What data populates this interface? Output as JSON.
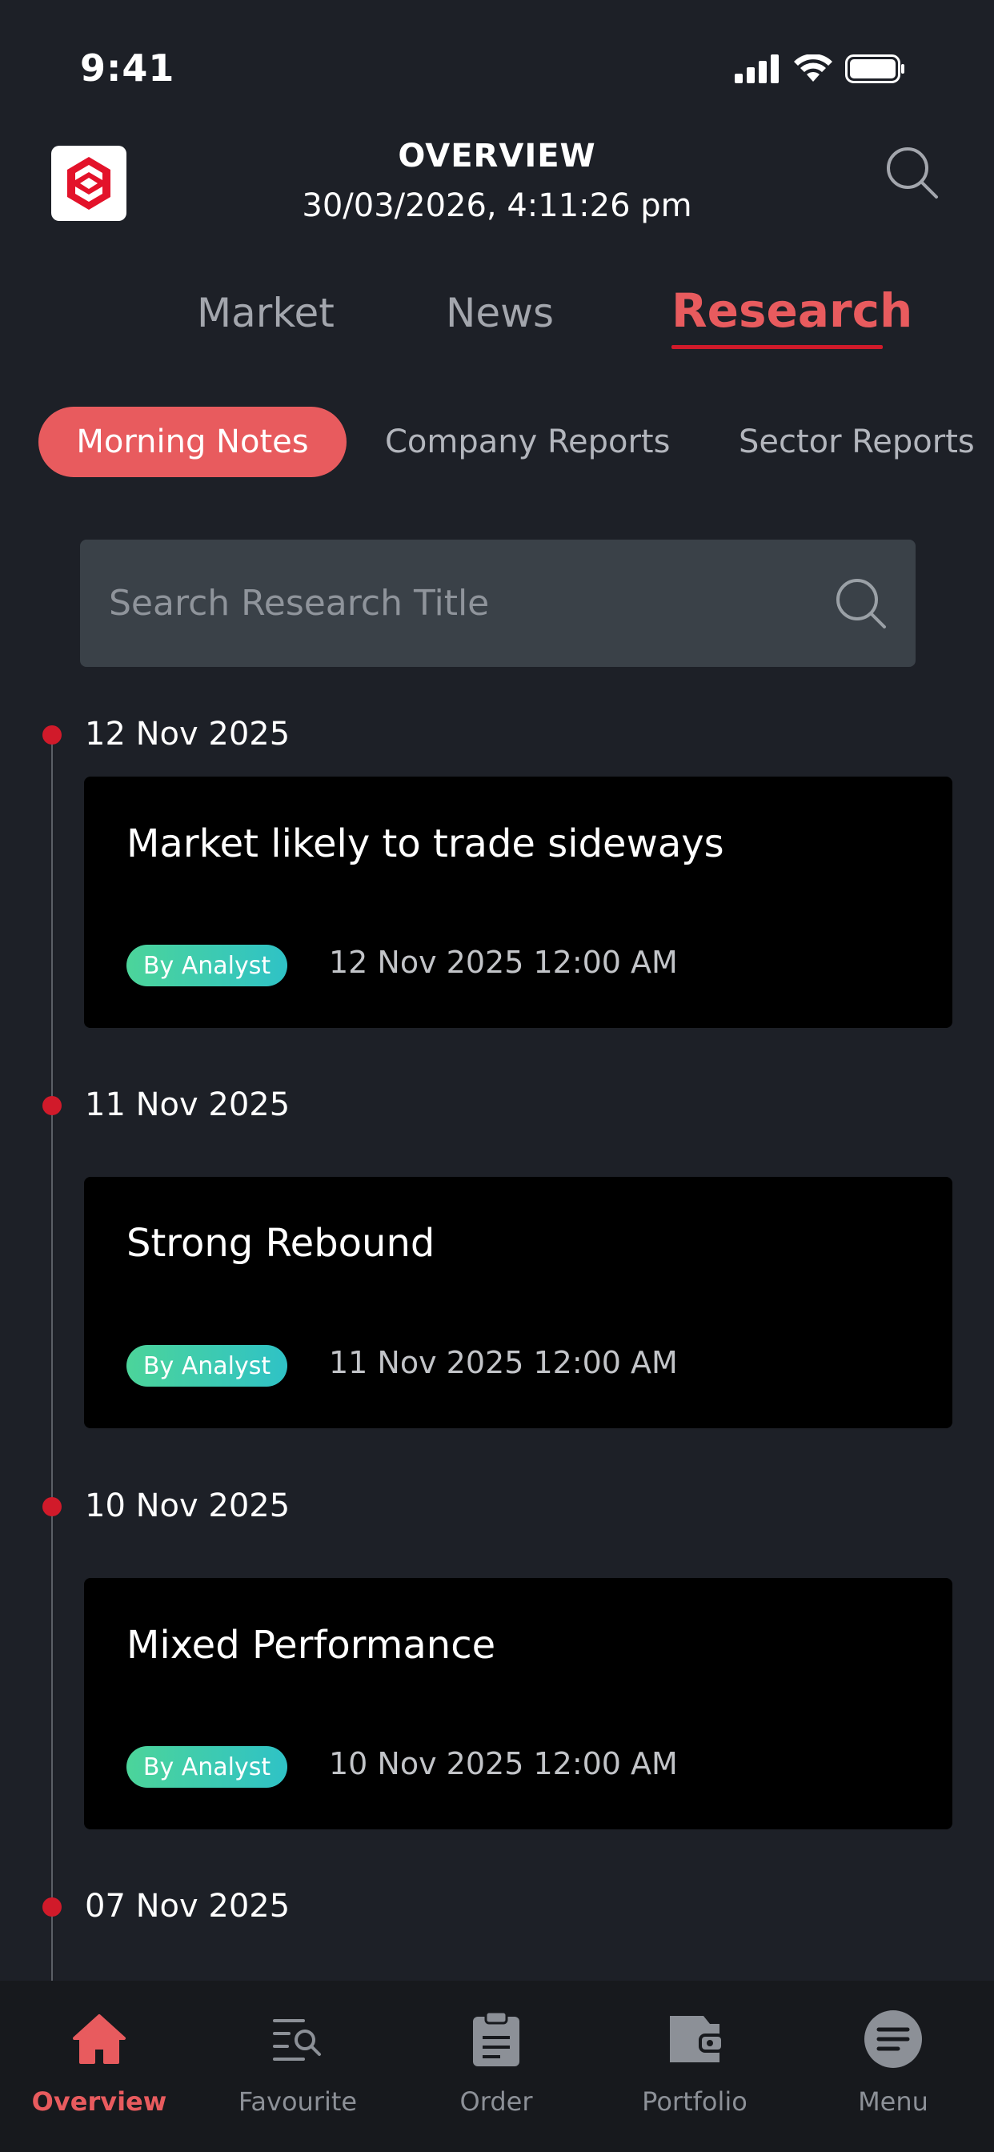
{
  "status_bar": {
    "time": "9:41"
  },
  "header": {
    "title": "OVERVIEW",
    "datetime": "30/03/2026, 4:11:26 pm"
  },
  "main_tabs": [
    {
      "label": "Market",
      "active": false
    },
    {
      "label": "News",
      "active": false
    },
    {
      "label": "Research",
      "active": true
    }
  ],
  "sub_tabs": [
    {
      "label": "Morning Notes",
      "active": true
    },
    {
      "label": "Company Reports",
      "active": false
    },
    {
      "label": "Sector Reports",
      "active": false
    }
  ],
  "search": {
    "placeholder": "Search Research Title",
    "value": ""
  },
  "timeline": [
    {
      "date": "12 Nov 2025",
      "card": {
        "title": "Market likely to trade sideways",
        "badge": "By Analyst",
        "datetime": "12 Nov 2025  12:00 AM"
      }
    },
    {
      "date": "11 Nov 2025",
      "card": {
        "title": "Strong Rebound",
        "badge": "By Analyst",
        "datetime": "11 Nov 2025  12:00 AM"
      }
    },
    {
      "date": "10 Nov 2025",
      "card": {
        "title": "Mixed Performance",
        "badge": "By Analyst",
        "datetime": "10 Nov 2025  12:00 AM"
      }
    },
    {
      "date": "07 Nov 2025"
    }
  ],
  "bottom_nav": [
    {
      "label": "Overview",
      "icon": "home-icon",
      "active": true
    },
    {
      "label": "Favourite",
      "icon": "list-search-icon",
      "active": false
    },
    {
      "label": "Order",
      "icon": "clipboard-icon",
      "active": false
    },
    {
      "label": "Portfolio",
      "icon": "wallet-icon",
      "active": false
    },
    {
      "label": "Menu",
      "icon": "menu-icon",
      "active": false
    }
  ],
  "colors": {
    "background": "#1d2027",
    "accent": "#e85b5e",
    "accent_dark": "#d11a2a",
    "card": "#000000",
    "search_field": "#3a4148",
    "badge_gradient_start": "#4cd49a",
    "badge_gradient_end": "#2fc2c6",
    "nav_background": "#17191d"
  }
}
